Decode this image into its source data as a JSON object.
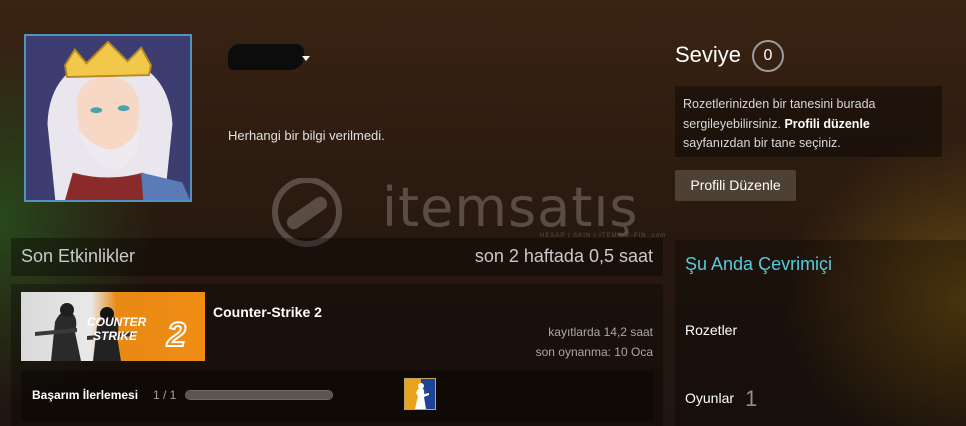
{
  "profile": {
    "persona_name": "██████",
    "summary": "Herhangi bir bilgi verilmedi."
  },
  "level": {
    "label": "Seviye",
    "value": "0"
  },
  "badge_info": {
    "text_before": "Rozetlerinizden bir tanesini burada sergileyebilirsiniz. ",
    "link": "Profili düzenle",
    "text_after": " sayfanızdan bir tane seçiniz."
  },
  "edit_profile_button": "Profili Düzenle",
  "watermark": {
    "text": "itemsatış",
    "sub": "HESAP / SKIN / ITEM / E-PIN .com"
  },
  "recent_activity": {
    "title": "Son Etkinlikler",
    "hours_summary": "son 2 haftada 0,5 saat",
    "games": [
      {
        "name": "Counter-Strike 2",
        "capsule_text_1": "COUNTER",
        "capsule_text_2": "STRIKE",
        "capsule_number": "2",
        "hours_on_record": "kayıtlarda 14,2 saat",
        "last_played": "son oynanma: 10 Oca",
        "achievement_label": "Başarım İlerlemesi",
        "achievement_count": "1 / 1",
        "achievement_progress": 1.0
      }
    ]
  },
  "right_column": {
    "online_status": "Şu Anda Çevrimiçi",
    "badges_link": "Rozetler",
    "games_link": "Oyunlar",
    "games_count": "1"
  },
  "colors": {
    "online": "#57cbde",
    "avatar_border": "#4f94bc",
    "capsule_orange": "#f08c12"
  }
}
